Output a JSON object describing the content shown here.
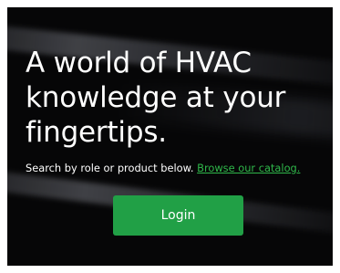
{
  "hero": {
    "headline": "A world of HVAC knowledge at your fingertips.",
    "subline_text": "Search by role or product below. ",
    "catalog_link": "Browse our catalog.",
    "login_label": "Login"
  },
  "colors": {
    "background": "#060607",
    "text": "#ffffff",
    "link": "#2fb84a",
    "button": "#21a046"
  }
}
